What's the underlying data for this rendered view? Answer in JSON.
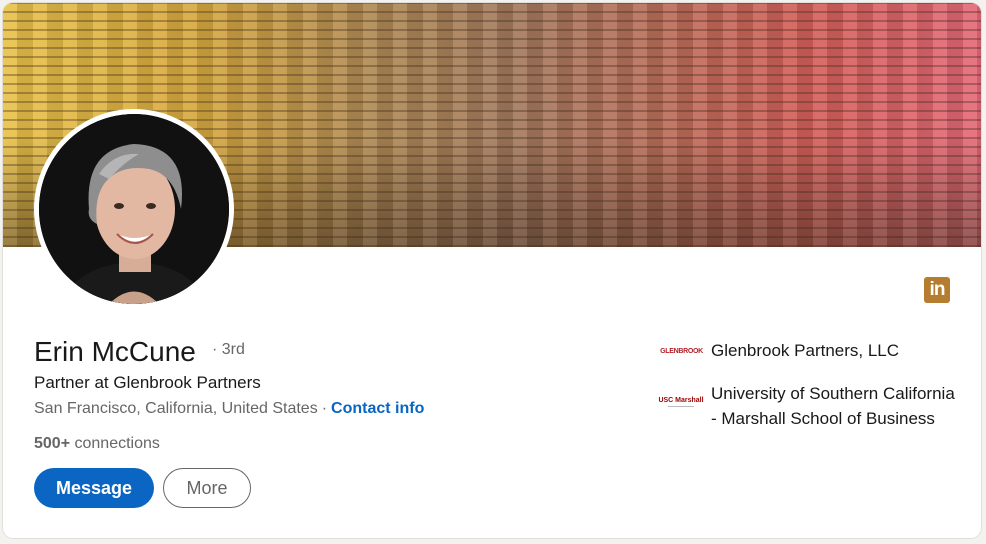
{
  "profile": {
    "name": "Erin McCune",
    "degree": "· 3rd",
    "headline": "Partner at Glenbrook Partners",
    "location": "San Francisco, California, United States",
    "separator": "·",
    "contact_info_label": "Contact info",
    "connections_count": "500+",
    "connections_label": "connections"
  },
  "actions": {
    "message_label": "Message",
    "more_label": "More"
  },
  "brand": {
    "logo_text": "in",
    "logo_color": "#b57d2f"
  },
  "organizations": [
    {
      "logo_text": "GLENBROOK",
      "name": "Glenbrook Partners, LLC"
    },
    {
      "logo_text": "USC Marshall",
      "name": "University of Southern California - Marshall School of Business"
    }
  ],
  "colors": {
    "primary_blue": "#0a66c2",
    "secondary_text": "#666666"
  }
}
